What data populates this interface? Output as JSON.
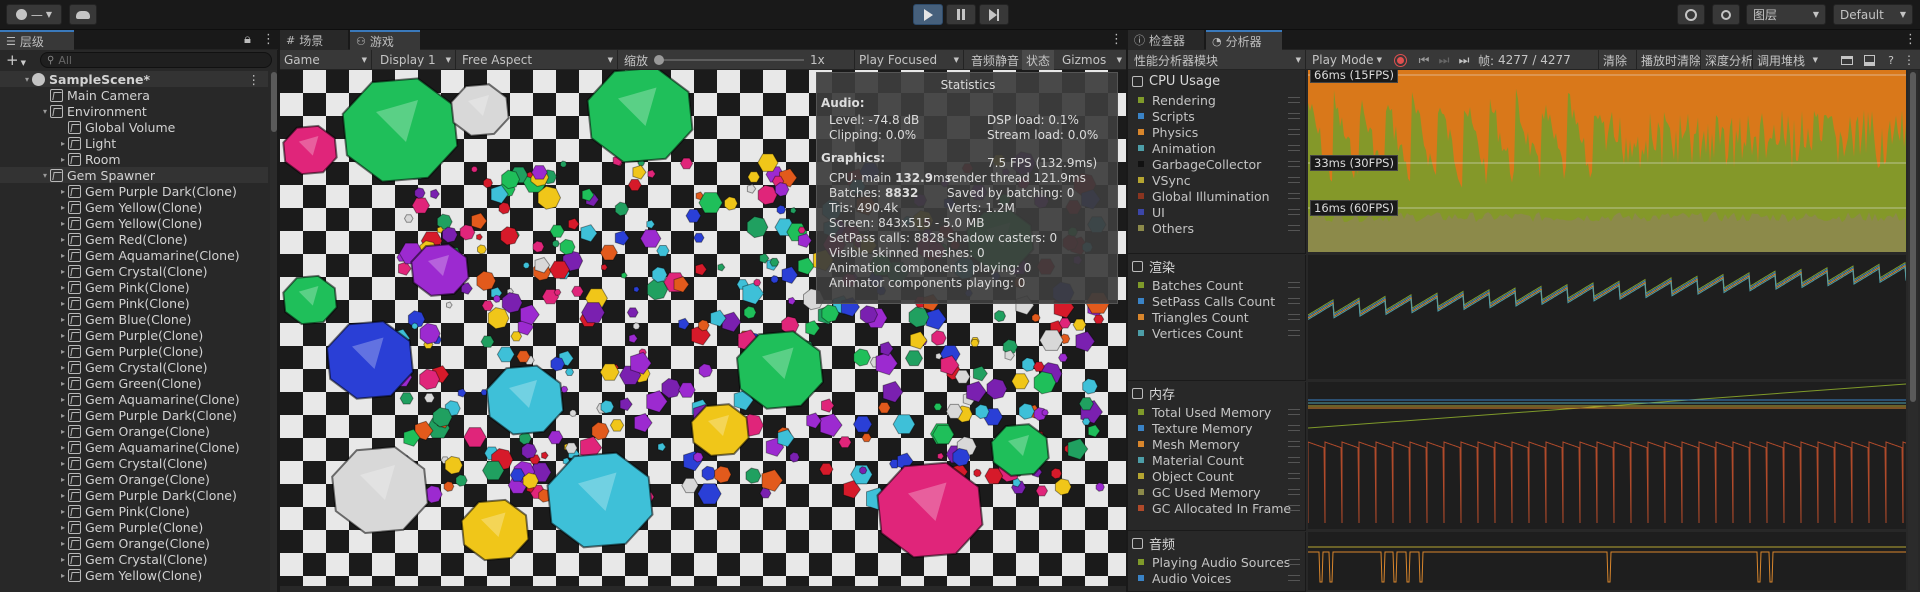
{
  "toolbar": {
    "account_label": "—",
    "play_icon": "play-icon",
    "pause_icon": "pause-icon",
    "step_icon": "step-icon",
    "history_icon": "history-icon",
    "search_icon": "search-icon",
    "layers_label": "图层",
    "layout_label": "Default"
  },
  "hierarchy": {
    "tab_label": "层级",
    "search_placeholder": "All",
    "items": [
      {
        "label": "SampleScene*",
        "indent": 0,
        "arrow": "▾",
        "type": "scene"
      },
      {
        "label": "Main Camera",
        "indent": 1,
        "arrow": "",
        "type": "go"
      },
      {
        "label": "Environment",
        "indent": 1,
        "arrow": "▾",
        "type": "go"
      },
      {
        "label": "Global Volume",
        "indent": 2,
        "arrow": "",
        "type": "go"
      },
      {
        "label": "Light",
        "indent": 2,
        "arrow": "▸",
        "type": "go"
      },
      {
        "label": "Room",
        "indent": 2,
        "arrow": "▸",
        "type": "go"
      },
      {
        "label": "Gem Spawner",
        "indent": 1,
        "arrow": "▾",
        "type": "go"
      },
      {
        "label": "Gem Purple Dark(Clone)",
        "indent": 2,
        "arrow": "▸",
        "type": "go"
      },
      {
        "label": "Gem Yellow(Clone)",
        "indent": 2,
        "arrow": "▸",
        "type": "go"
      },
      {
        "label": "Gem Yellow(Clone)",
        "indent": 2,
        "arrow": "▸",
        "type": "go"
      },
      {
        "label": "Gem Red(Clone)",
        "indent": 2,
        "arrow": "▸",
        "type": "go"
      },
      {
        "label": "Gem Aquamarine(Clone)",
        "indent": 2,
        "arrow": "▸",
        "type": "go"
      },
      {
        "label": "Gem Crystal(Clone)",
        "indent": 2,
        "arrow": "▸",
        "type": "go"
      },
      {
        "label": "Gem Pink(Clone)",
        "indent": 2,
        "arrow": "▸",
        "type": "go"
      },
      {
        "label": "Gem Pink(Clone)",
        "indent": 2,
        "arrow": "▸",
        "type": "go"
      },
      {
        "label": "Gem Blue(Clone)",
        "indent": 2,
        "arrow": "▸",
        "type": "go"
      },
      {
        "label": "Gem Purple(Clone)",
        "indent": 2,
        "arrow": "▸",
        "type": "go"
      },
      {
        "label": "Gem Purple(Clone)",
        "indent": 2,
        "arrow": "▸",
        "type": "go"
      },
      {
        "label": "Gem Crystal(Clone)",
        "indent": 2,
        "arrow": "▸",
        "type": "go"
      },
      {
        "label": "Gem Green(Clone)",
        "indent": 2,
        "arrow": "▸",
        "type": "go"
      },
      {
        "label": "Gem Aquamarine(Clone)",
        "indent": 2,
        "arrow": "▸",
        "type": "go"
      },
      {
        "label": "Gem Purple Dark(Clone)",
        "indent": 2,
        "arrow": "▸",
        "type": "go"
      },
      {
        "label": "Gem Orange(Clone)",
        "indent": 2,
        "arrow": "▸",
        "type": "go"
      },
      {
        "label": "Gem Aquamarine(Clone)",
        "indent": 2,
        "arrow": "▸",
        "type": "go"
      },
      {
        "label": "Gem Crystal(Clone)",
        "indent": 2,
        "arrow": "▸",
        "type": "go"
      },
      {
        "label": "Gem Orange(Clone)",
        "indent": 2,
        "arrow": "▸",
        "type": "go"
      },
      {
        "label": "Gem Purple Dark(Clone)",
        "indent": 2,
        "arrow": "▸",
        "type": "go"
      },
      {
        "label": "Gem Pink(Clone)",
        "indent": 2,
        "arrow": "▸",
        "type": "go"
      },
      {
        "label": "Gem Purple(Clone)",
        "indent": 2,
        "arrow": "▸",
        "type": "go"
      },
      {
        "label": "Gem Orange(Clone)",
        "indent": 2,
        "arrow": "▸",
        "type": "go"
      },
      {
        "label": "Gem Crystal(Clone)",
        "indent": 2,
        "arrow": "▸",
        "type": "go"
      },
      {
        "label": "Gem Yellow(Clone)",
        "indent": 2,
        "arrow": "▸",
        "type": "go"
      }
    ]
  },
  "center_tabs": {
    "scene_label": "场景",
    "game_label": "游戏"
  },
  "game_toolbar": {
    "game_label": "Game",
    "display_label": "Display 1",
    "aspect_label": "Free Aspect",
    "scale_label": "缩放",
    "scale_value": "1x",
    "play_focused_label": "Play Focused",
    "mute_label": "音频静音",
    "stats_label": "状态",
    "gizmos_label": "Gizmos"
  },
  "stats": {
    "title": "Statistics",
    "audio_heading": "Audio:",
    "level": "Level: -74.8 dB",
    "dsp_load": "DSP load: 0.1%",
    "clipping": "Clipping: 0.0%",
    "stream_load": "Stream load: 0.0%",
    "graphics_heading": "Graphics:",
    "fps": "7.5 FPS (132.9ms)",
    "cpu_main_prefix": "CPU: main ",
    "cpu_main_value": "132.9",
    "cpu_main_unit": "ms",
    "render_thread": "render thread 121.9ms",
    "batches_prefix": "Batches: ",
    "batches_value": "8832",
    "saved_by_batching": "Saved by batching: 0",
    "tris": "Tris: 490.4k",
    "verts": "Verts: 1.2M",
    "screen": "Screen: 843x515 - 5.0 MB",
    "setpass": "SetPass calls: 8828",
    "shadow_casters": "Shadow casters: 0",
    "skinned_meshes": "Visible skinned meshes: 0",
    "animation_components": "Animation components playing: 0",
    "animator_components": "Animator components playing: 0"
  },
  "right_tabs": {
    "inspector_label": "检查器",
    "profiler_label": "分析器"
  },
  "profiler_toolbar": {
    "modules_label": "性能分析器模块",
    "mode_label": "Play Mode",
    "frame_label": "帧:",
    "frame_value": "4277 / 4277",
    "clear_label": "清除",
    "clear_on_play_label": "播放时清除",
    "deep_profile_label": "深度分析",
    "call_stacks_label": "调用堆栈"
  },
  "profiler_modules": [
    {
      "title": "CPU Usage",
      "icon": "cpu-icon",
      "series": [
        {
          "label": "Rendering",
          "color": "#7f9a2a"
        },
        {
          "label": "Scripts",
          "color": "#3a83c6"
        },
        {
          "label": "Physics",
          "color": "#d9862c"
        },
        {
          "label": "Animation",
          "color": "#4d9ea8"
        },
        {
          "label": "GarbageCollector",
          "color": "#111111"
        },
        {
          "label": "VSync",
          "color": "#b5a531"
        },
        {
          "label": "Global Illumination",
          "color": "#8a3520"
        },
        {
          "label": "UI",
          "color": "#3c46a8"
        },
        {
          "label": "Others",
          "color": "#8c8a4a"
        }
      ],
      "fps_lines": [
        "66ms (15FPS)",
        "33ms (30FPS)",
        "16ms (60FPS)"
      ]
    },
    {
      "title": "渲染",
      "icon": "rendering-icon",
      "series": [
        {
          "label": "Batches Count",
          "color": "#7f9a2a"
        },
        {
          "label": "SetPass Calls Count",
          "color": "#3a83c6"
        },
        {
          "label": "Triangles Count",
          "color": "#d9862c"
        },
        {
          "label": "Vertices Count",
          "color": "#4d9ea8"
        }
      ]
    },
    {
      "title": "内存",
      "icon": "memory-icon",
      "series": [
        {
          "label": "Total Used Memory",
          "color": "#7f9a2a"
        },
        {
          "label": "Texture Memory",
          "color": "#3a83c6"
        },
        {
          "label": "Mesh Memory",
          "color": "#d9862c"
        },
        {
          "label": "Material Count",
          "color": "#4d9ea8"
        },
        {
          "label": "Object Count",
          "color": "#b5a531"
        },
        {
          "label": "GC Used Memory",
          "color": "#8c8a4a"
        },
        {
          "label": "GC Allocated In Frame",
          "color": "#b04a2a"
        }
      ]
    },
    {
      "title": "音频",
      "icon": "audio-icon",
      "series": [
        {
          "label": "Playing Audio Sources",
          "color": "#7f9a2a"
        },
        {
          "label": "Audio Voices",
          "color": "#3a83c6"
        }
      ]
    }
  ]
}
